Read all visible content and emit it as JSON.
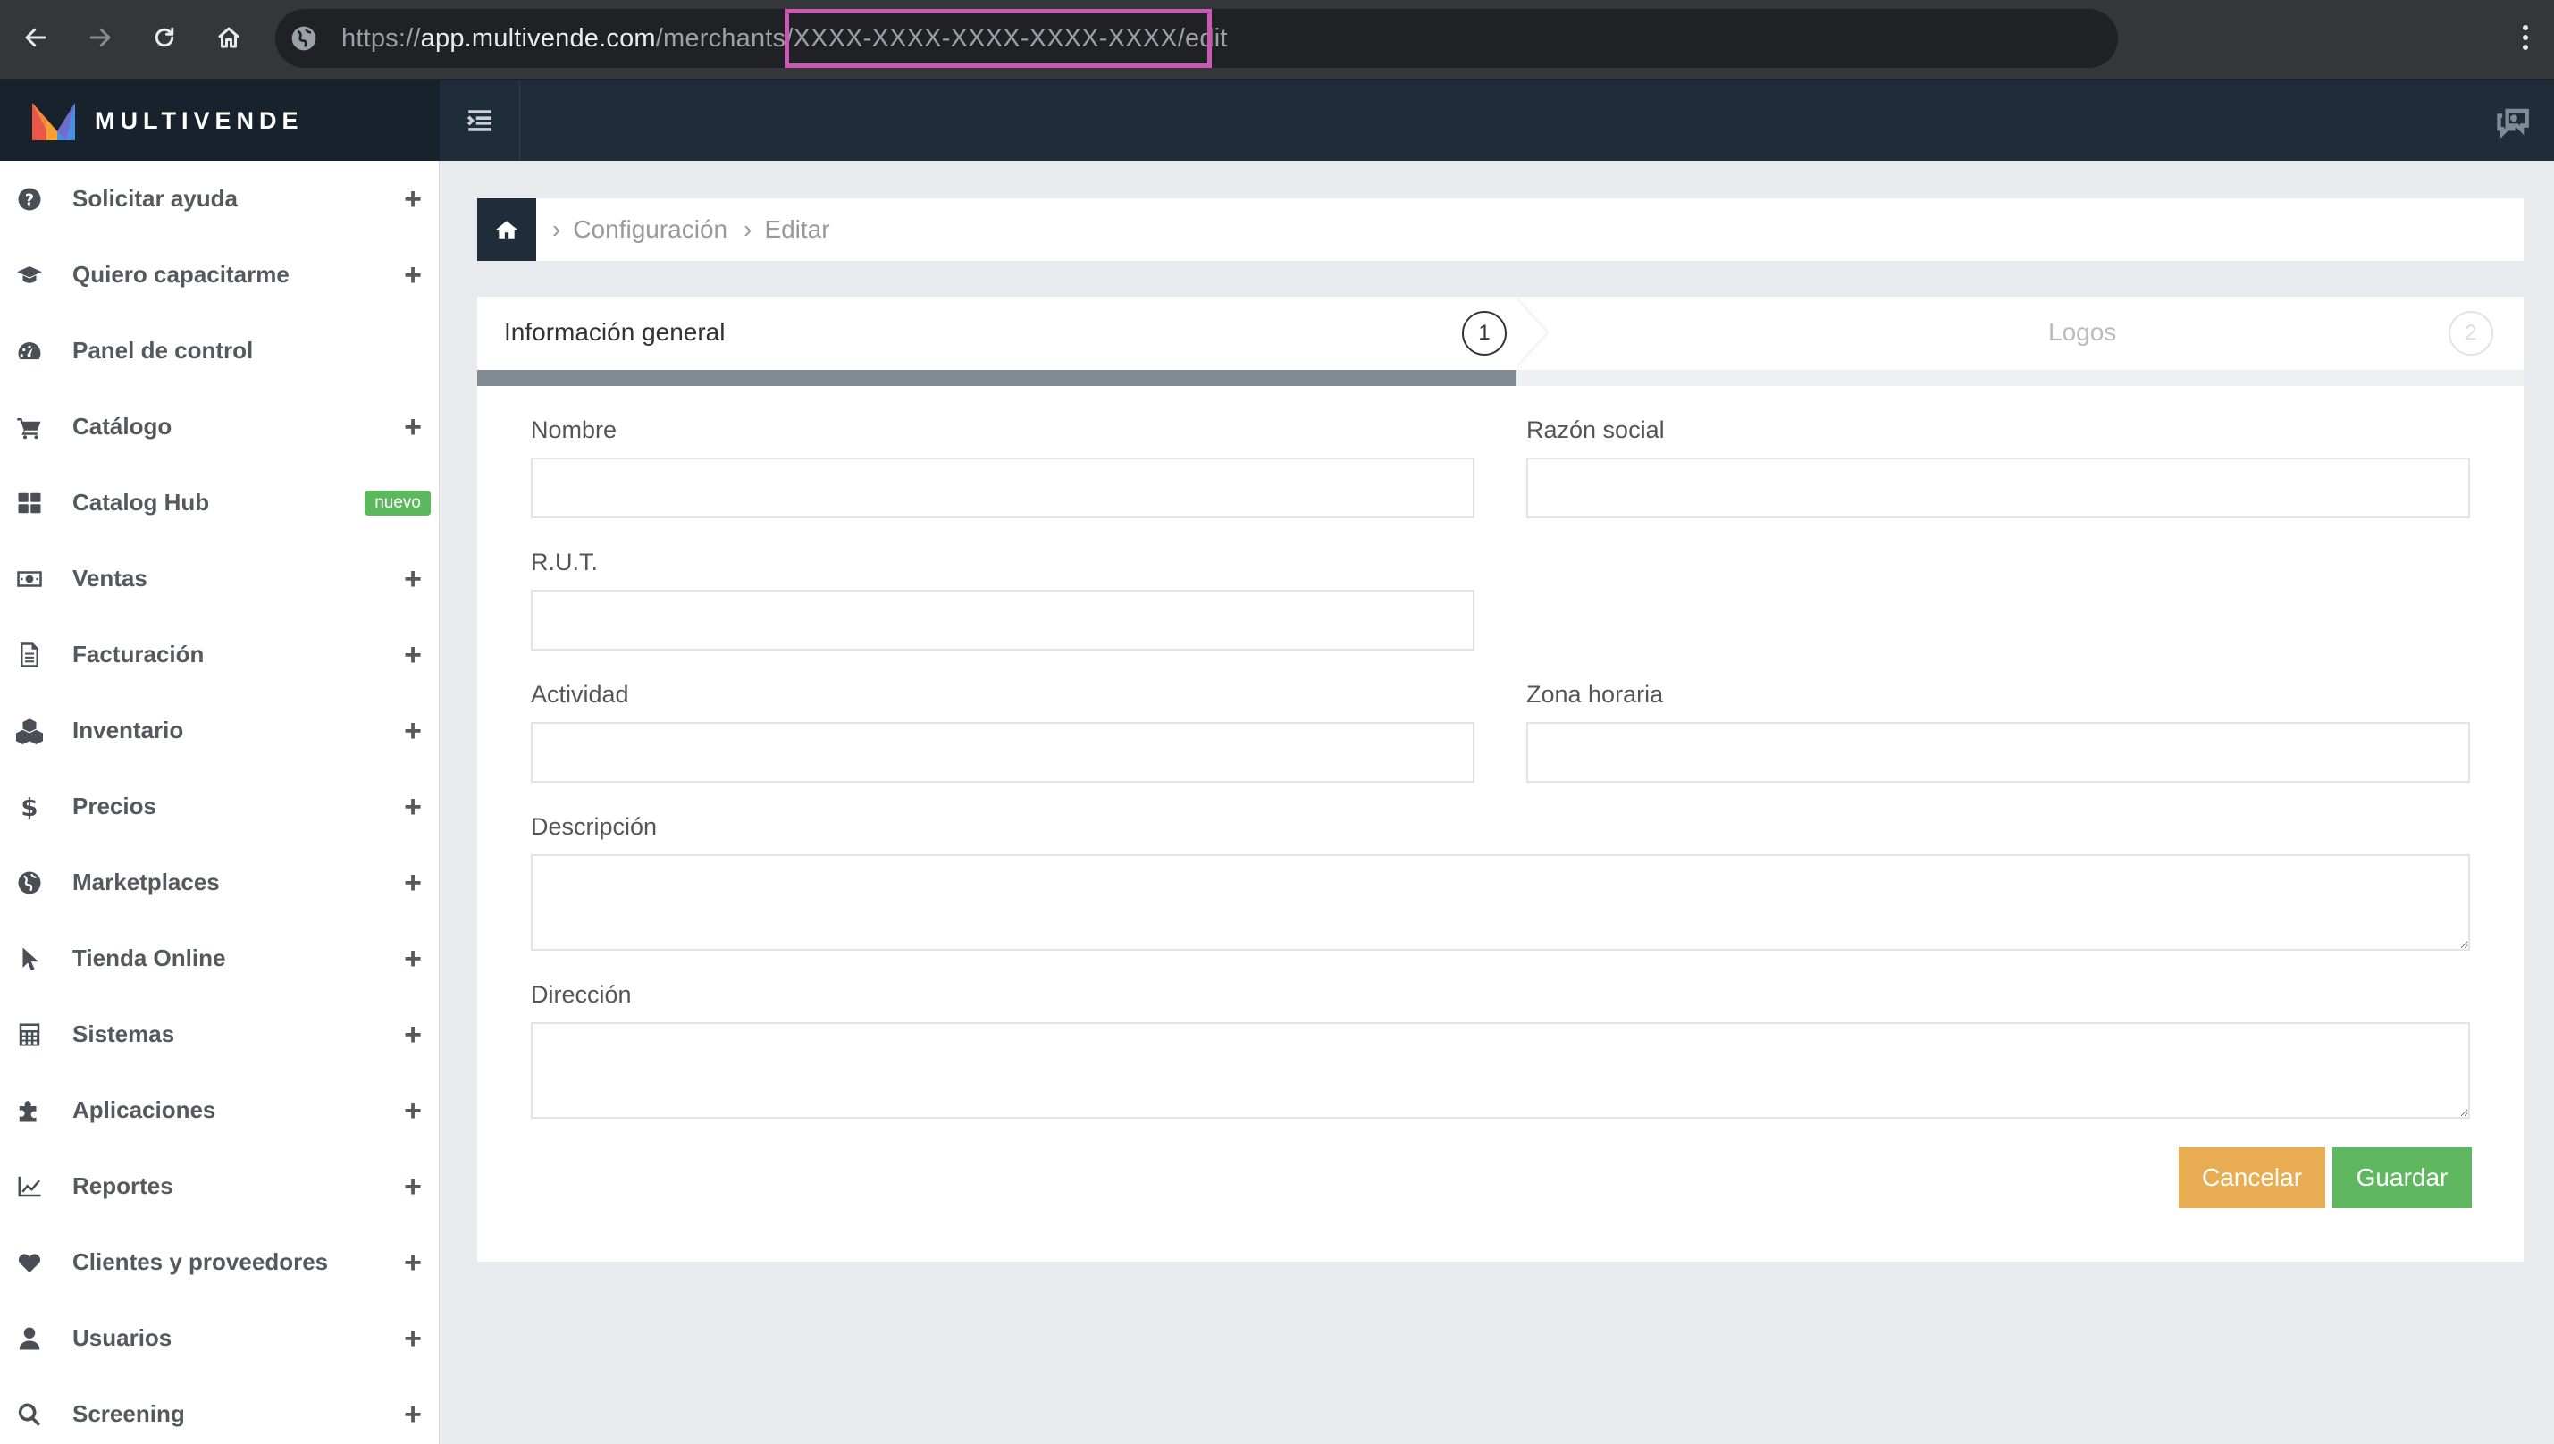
{
  "browser": {
    "url_prefix": "https://",
    "url_host": "app.multivende.com",
    "url_path": "/merchants/XXXX-XXXX-XXXX-XXXX-XXXX/edit"
  },
  "app": {
    "brand_name": "MULTIVENDE"
  },
  "sidebar": {
    "items": [
      {
        "label": "Solicitar ayuda",
        "icon": "question-circle-icon",
        "expand": "+"
      },
      {
        "label": "Quiero capacitarme",
        "icon": "graduation-cap-icon",
        "expand": "+"
      },
      {
        "label": "Panel de control",
        "icon": "dashboard-gauge-icon",
        "expand": ""
      },
      {
        "label": "Catálogo",
        "icon": "shopping-cart-icon",
        "expand": "+"
      },
      {
        "label": "Catalog Hub",
        "icon": "grid-icon",
        "badge": "nuevo"
      },
      {
        "label": "Ventas",
        "icon": "money-bill-icon",
        "expand": "+"
      },
      {
        "label": "Facturación",
        "icon": "file-text-icon",
        "expand": "+"
      },
      {
        "label": "Inventario",
        "icon": "cubes-icon",
        "expand": "+"
      },
      {
        "label": "Precios",
        "icon": "dollar-icon",
        "expand": "+"
      },
      {
        "label": "Marketplaces",
        "icon": "globe-icon",
        "expand": "+"
      },
      {
        "label": "Tienda Online",
        "icon": "mouse-pointer-icon",
        "expand": "+"
      },
      {
        "label": "Sistemas",
        "icon": "calculator-icon",
        "expand": "+"
      },
      {
        "label": "Aplicaciones",
        "icon": "puzzle-piece-icon",
        "expand": "+"
      },
      {
        "label": "Reportes",
        "icon": "line-chart-icon",
        "expand": "+"
      },
      {
        "label": "Clientes y proveedores",
        "icon": "heart-icon",
        "expand": "+"
      },
      {
        "label": "Usuarios",
        "icon": "user-icon",
        "expand": "+"
      },
      {
        "label": "Screening",
        "icon": "search-icon",
        "expand": "+"
      }
    ]
  },
  "breadcrumb": {
    "items": [
      "Configuración",
      "Editar"
    ]
  },
  "wizard": {
    "steps": [
      {
        "title": "Información general",
        "number": "1"
      },
      {
        "title": "Logos",
        "number": "2"
      }
    ],
    "progress_fraction": 0.508
  },
  "form": {
    "nombre": {
      "label": "Nombre",
      "value": ""
    },
    "razon_social": {
      "label": "Razón social",
      "value": ""
    },
    "rut": {
      "label": "R.U.T.",
      "value": ""
    },
    "actividad": {
      "label": "Actividad",
      "value": ""
    },
    "zona_horaria": {
      "label": "Zona horaria",
      "value": ""
    },
    "descripcion": {
      "label": "Descripción",
      "value": ""
    },
    "direccion": {
      "label": "Dirección",
      "value": ""
    },
    "cancel_label": "Cancelar",
    "save_label": "Guardar"
  },
  "colors": {
    "topbar": "#1f2d3b",
    "cancel": "#e8ad52",
    "save": "#5fb760",
    "badge": "#5cb85c",
    "url_highlight": "#c95ab4"
  }
}
